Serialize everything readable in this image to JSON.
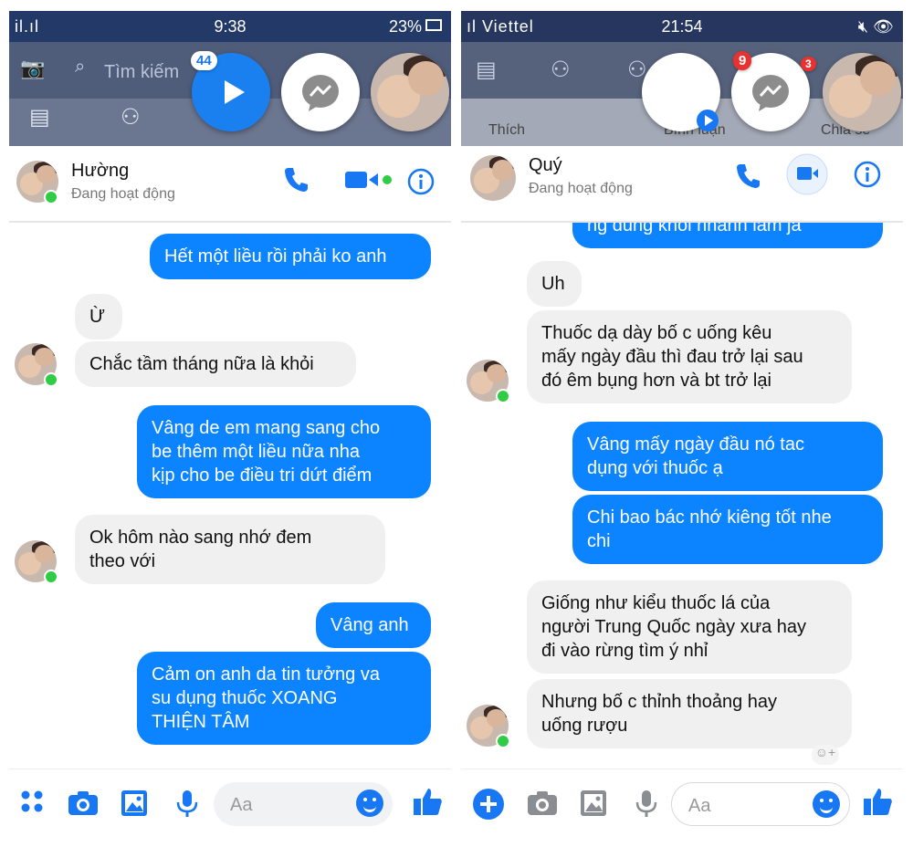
{
  "left": {
    "status": {
      "signal": "il.ıl",
      "time": "9:38",
      "battery": "23%"
    },
    "fb": {
      "search_placeholder": "Tìm kiếm"
    },
    "video_badge": "44",
    "contact": {
      "name": "Hường",
      "status": "Đang hoạt động"
    },
    "messages": [
      {
        "dir": "out",
        "text": "Hết một liều rồi phải ko anh"
      },
      {
        "dir": "in",
        "text": "Ừ"
      },
      {
        "dir": "in",
        "text": "Chắc tầm tháng nữa là khỏi"
      },
      {
        "dir": "out",
        "text": "Vâng de em mang sang cho\nbe thêm một liều nữa nha\nkịp cho be điều tri dứt điểm"
      },
      {
        "dir": "in",
        "text": "Ok hôm nào sang nhớ đem\ntheo với"
      },
      {
        "dir": "out",
        "text": "Vâng anh"
      },
      {
        "dir": "out",
        "text": "Cảm on anh da tin tưởng va\nsu dụng thuốc XOANG\nTHIỆN TÂM"
      }
    ],
    "composer": {
      "placeholder": "Aa"
    }
  },
  "right": {
    "status": {
      "carrier": "ıl Viettel",
      "time": "21:54"
    },
    "fb": {
      "tab_like": "Thích",
      "tab_comment": "Bình luận",
      "tab_share": "Chia sẻ"
    },
    "messenger_badge": "9",
    "notif_badge": "3",
    "contact": {
      "name": "Quý",
      "status": "Đang hoạt động"
    },
    "messages": [
      {
        "dir": "out",
        "text": "ng dung khoi nhanh lam ja"
      },
      {
        "dir": "in",
        "text": "Uh"
      },
      {
        "dir": "in",
        "text": "Thuốc dạ dày bố c uống kêu\nmấy ngày đầu thì đau trở lại sau\nđó êm bụng hơn và bt trở lại"
      },
      {
        "dir": "out",
        "text": "Vâng mấy ngày đầu nó tac\ndụng với thuốc ạ"
      },
      {
        "dir": "out",
        "text": "Chi bao bác nhớ kiêng tốt nhe\nchi"
      },
      {
        "dir": "in",
        "text": "Giống như kiểu thuốc lá của\nngười Trung Quốc ngày xưa hay\nđi vào rừng tìm ý nhỉ"
      },
      {
        "dir": "in",
        "text": "Nhưng bố c thỉnh thoảng hay\nuống rượu"
      }
    ],
    "composer": {
      "placeholder": "Aa"
    }
  },
  "colors": {
    "accent": "#1877f2",
    "outgoing": "#0d84ff",
    "incoming": "#f0f0f0",
    "online": "#31cc46"
  }
}
